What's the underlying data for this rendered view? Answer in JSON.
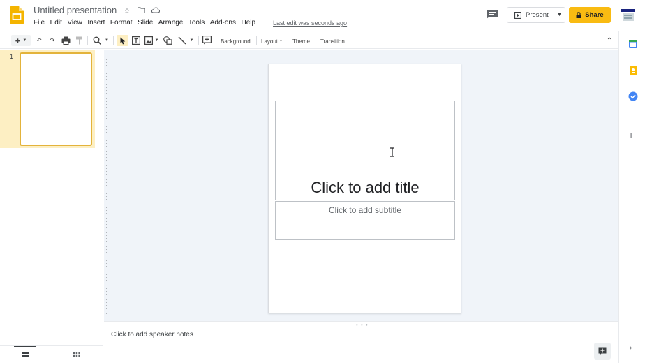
{
  "header": {
    "doc_title": "Untitled presentation",
    "last_edit": "Last edit was seconds ago",
    "present_label": "Present",
    "share_label": "Share",
    "star_icon": "star-icon",
    "folder_icon": "move-to-folder-icon",
    "cloud_icon": "cloud-saved-icon"
  },
  "menu": {
    "items": [
      "File",
      "Edit",
      "View",
      "Insert",
      "Format",
      "Slide",
      "Arrange",
      "Tools",
      "Add-ons",
      "Help"
    ]
  },
  "toolbar": {
    "background_label": "Background",
    "layout_label": "Layout",
    "theme_label": "Theme",
    "transition_label": "Transition"
  },
  "filmstrip": {
    "slide_number": "1"
  },
  "slide": {
    "title_placeholder": "Click to add title",
    "subtitle_placeholder": "Click to add subtitle"
  },
  "notes": {
    "placeholder": "Click to add speaker notes"
  },
  "colors": {
    "accent": "#f9bb12",
    "selection": "#fdefc3"
  }
}
